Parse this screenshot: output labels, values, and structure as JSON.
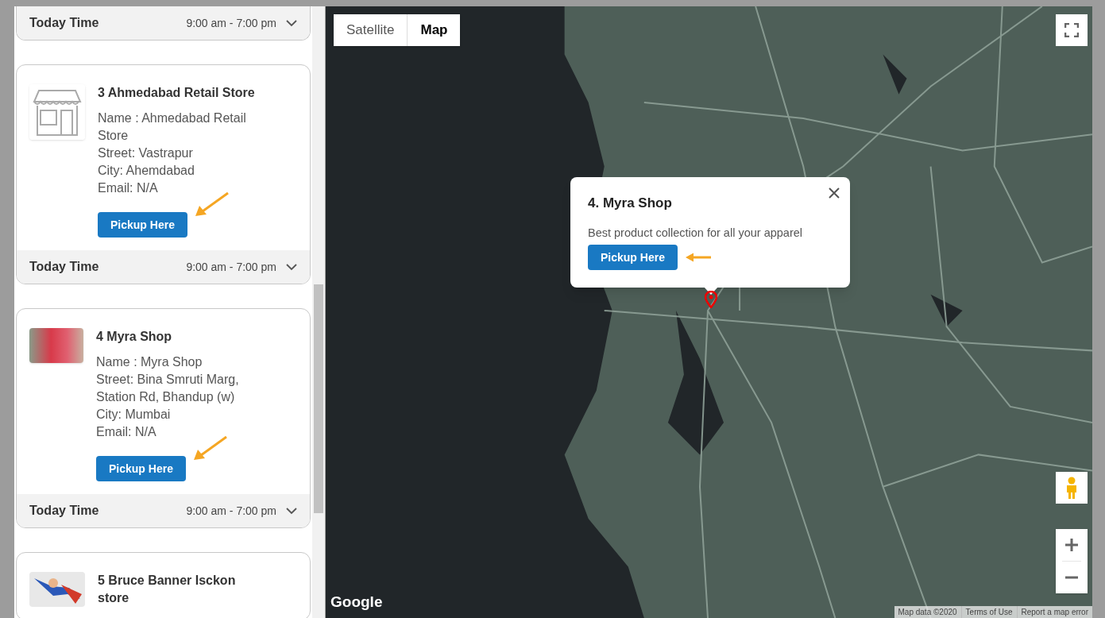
{
  "stores": [
    {
      "kind": "none",
      "footer": {
        "label": "Today Time",
        "hours": "9:00 am - 7:00 pm"
      }
    },
    {
      "kind": "icon",
      "title": "3 Ahmedabad Retail Store",
      "details": [
        "Name : Ahmedabad Retail Store",
        "Street: Vastrapur",
        "City: Ahemdabad",
        "Email: N/A"
      ],
      "button": "Pickup Here",
      "footer": {
        "label": "Today Time",
        "hours": "9:00 am - 7:00 pm"
      }
    },
    {
      "kind": "photo",
      "title": "4 Myra Shop",
      "details": [
        "Name : Myra Shop",
        "Street: Bina Smruti Marg, Station Rd, Bhandup (w)",
        "City: Mumbai",
        "Email: N/A"
      ],
      "button": "Pickup Here",
      "footer": {
        "label": "Today Time",
        "hours": "9:00 am - 7:00 pm"
      }
    },
    {
      "kind": "illustration",
      "title": "5 Bruce Banner Isckon store"
    }
  ],
  "map": {
    "map_types": [
      {
        "label": "Satellite",
        "selected": false
      },
      {
        "label": "Map",
        "selected": true
      }
    ],
    "popup": {
      "title": "4. Myra Shop",
      "description": "Best product collection for all your apparel",
      "button": "Pickup Here"
    },
    "logo": "Google",
    "attribution": [
      "Map data ©2020",
      "Terms of Use",
      "Report a map error"
    ]
  }
}
